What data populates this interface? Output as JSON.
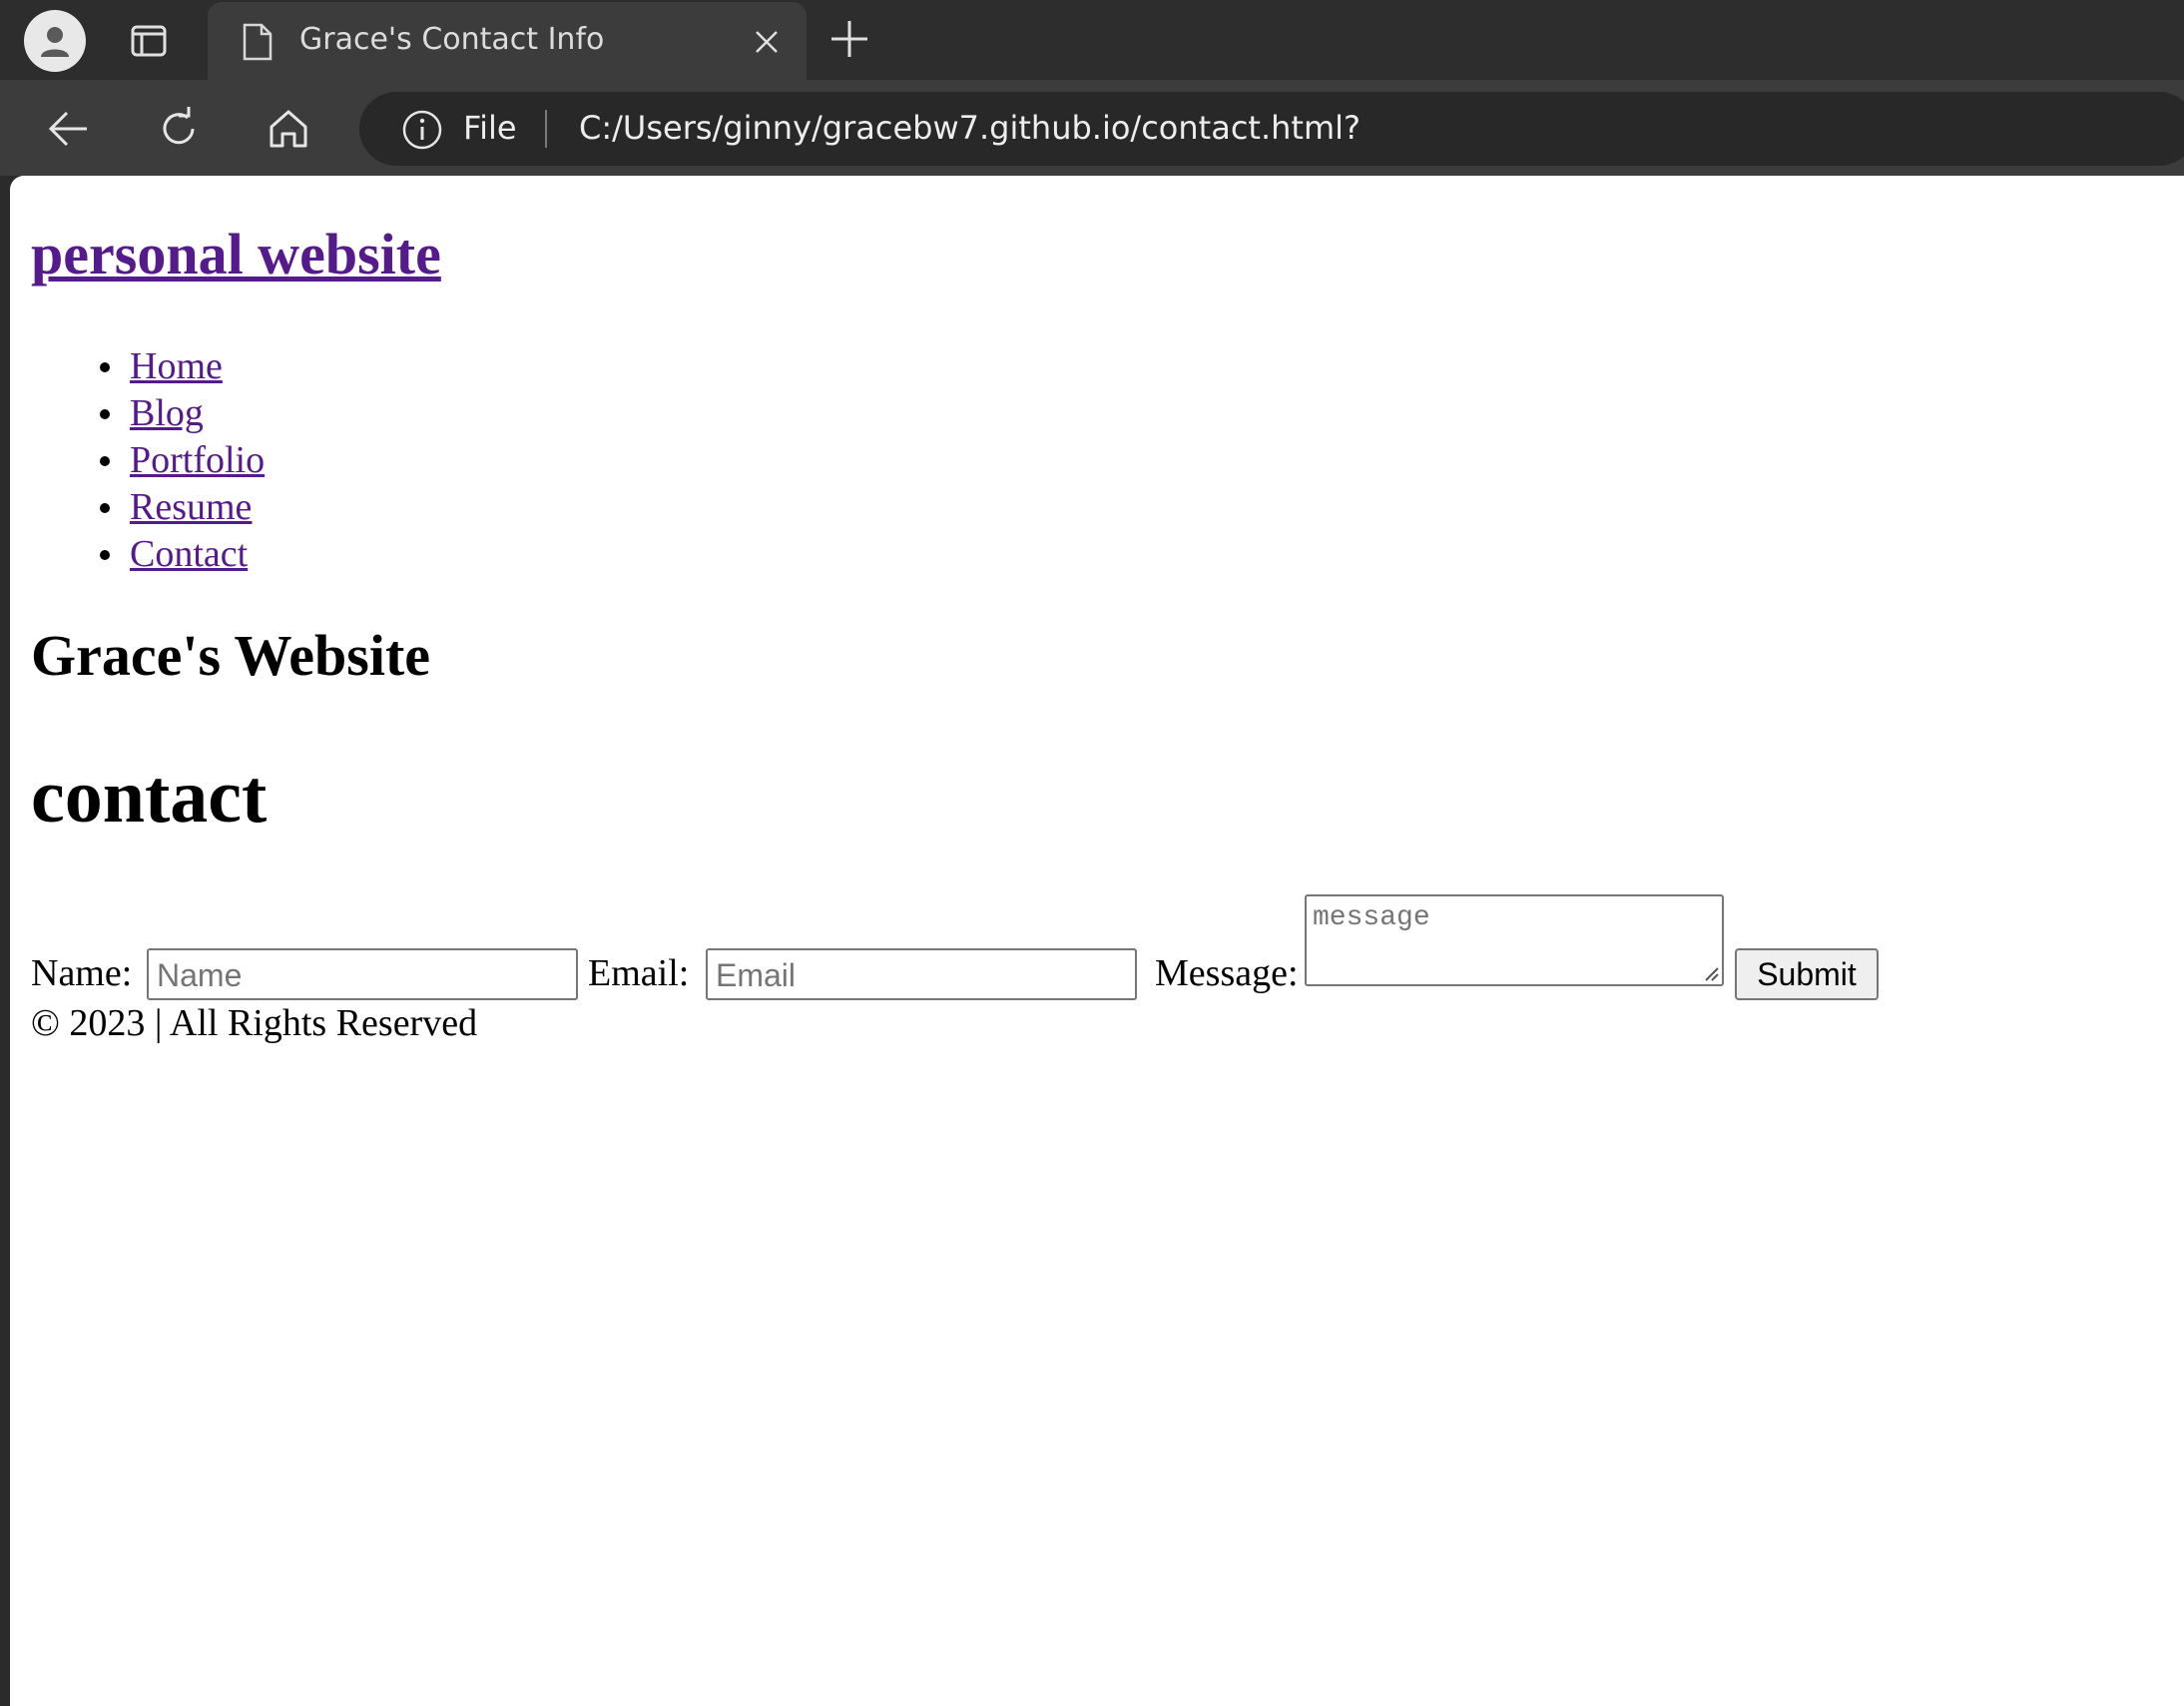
{
  "browser": {
    "tab_title": "Grace's Contact Info",
    "scheme_label": "File",
    "url": "C:/Users/ginny/gracebw7.github.io/contact.html?",
    "icons": {
      "profile": "profile-icon",
      "tabs": "tab-actions-icon",
      "favicon": "file-icon",
      "close": "close-icon",
      "new_tab": "plus-icon",
      "back": "back-arrow-icon",
      "reload": "reload-icon",
      "home": "home-icon",
      "info": "info-icon"
    }
  },
  "page": {
    "site_link": "personal website",
    "nav": [
      {
        "label": "Home"
      },
      {
        "label": "Blog"
      },
      {
        "label": "Portfolio"
      },
      {
        "label": "Resume"
      },
      {
        "label": "Contact"
      }
    ],
    "site_heading": "Grace's Website",
    "page_heading": "contact",
    "form": {
      "name_label": "Name:",
      "name_placeholder": "Name",
      "email_label": "Email:",
      "email_placeholder": "Email",
      "message_label": "Message:",
      "message_placeholder": "message",
      "submit_label": "Submit"
    },
    "footer": "© 2023 | All Rights Reserved"
  },
  "colors": {
    "link_visited": "#551a8b",
    "chrome_dark": "#2d2d2d",
    "toolbar": "#3c3c3c"
  }
}
